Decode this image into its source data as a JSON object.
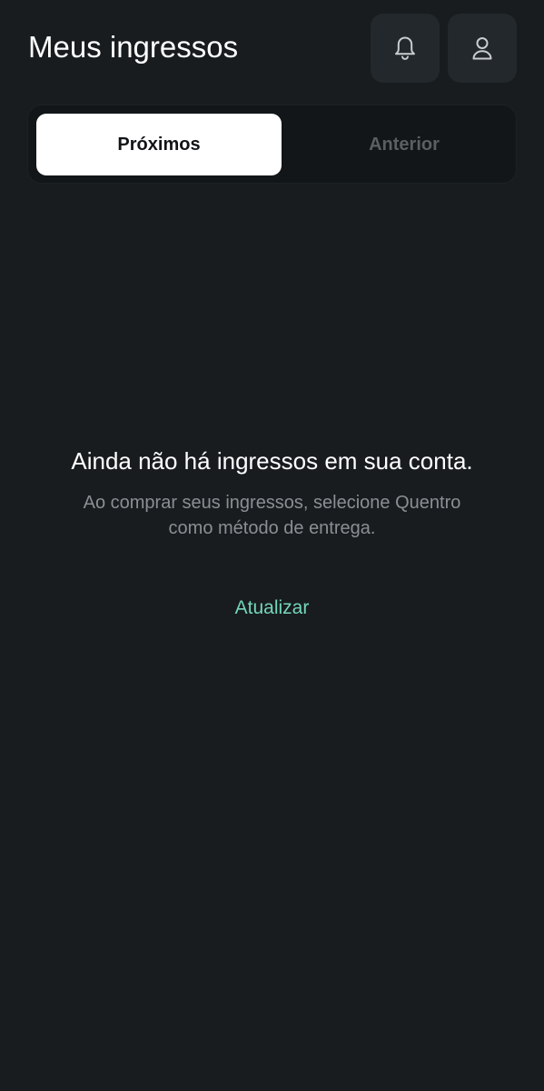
{
  "header": {
    "title": "Meus ingressos",
    "notifications_icon": "bell-icon",
    "profile_icon": "user-icon"
  },
  "tabs": [
    {
      "label": "Próximos",
      "selected": true
    },
    {
      "label": "Anterior",
      "selected": false
    }
  ],
  "empty_state": {
    "title": "Ainda não há ingressos em sua conta.",
    "subtitle_line1": "Ao comprar seus ingressos, selecione Quentro",
    "subtitle_line2": "como método de entrega.",
    "action_label": "Atualizar"
  },
  "colors": {
    "background": "#181c1f",
    "accent": "#74d6b6",
    "tab_active_bg": "#ffffff",
    "icon_button_bg": "#22282b"
  }
}
